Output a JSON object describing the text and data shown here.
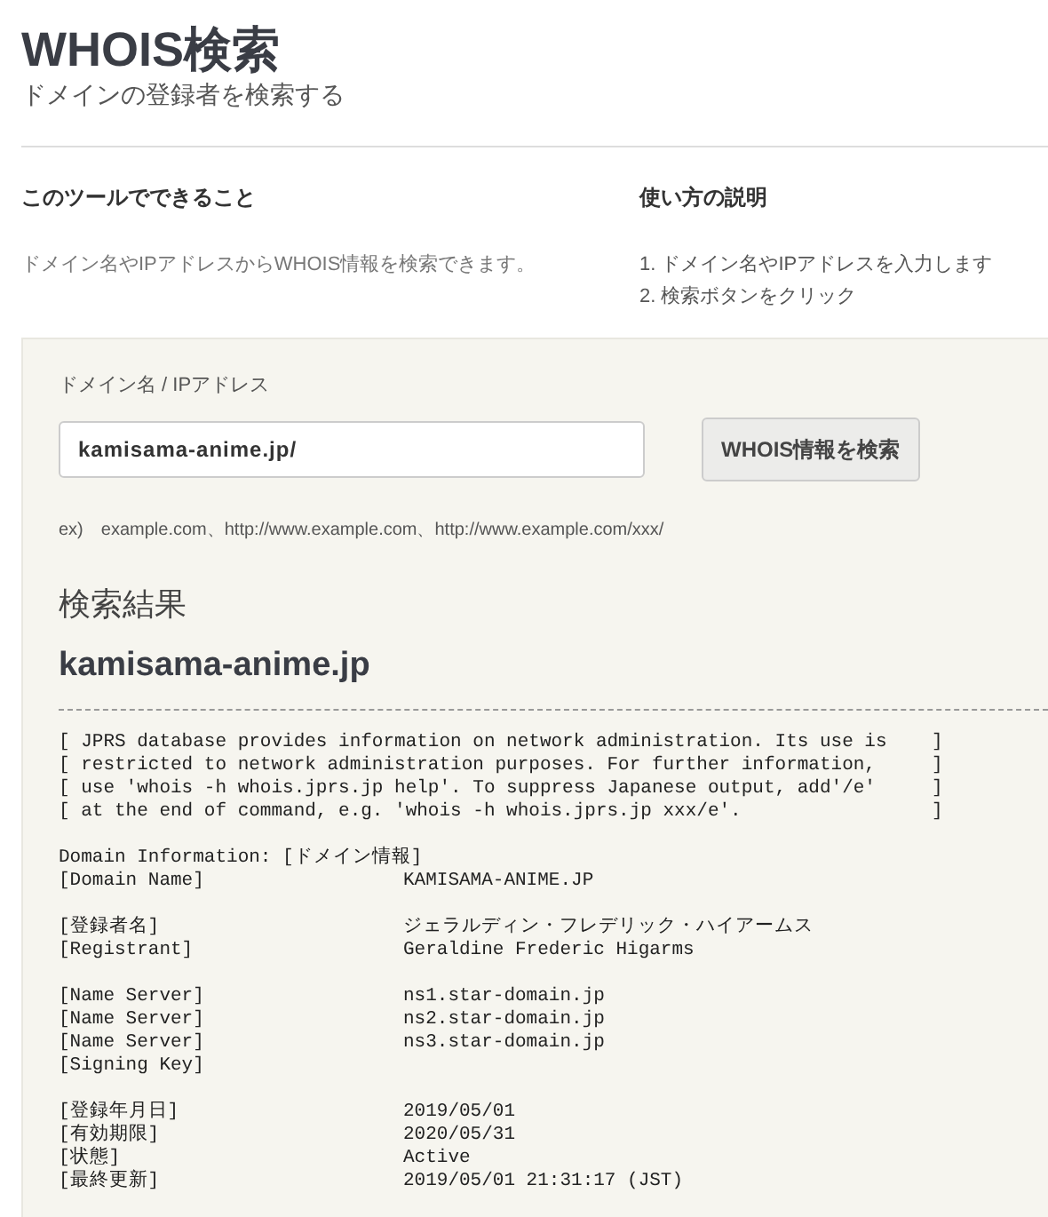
{
  "header": {
    "title": "WHOIS検索",
    "subtitle": "ドメインの登録者を検索する"
  },
  "intro": [
    {
      "heading": "このツールでできること",
      "kind": "text",
      "lines": [
        "ドメイン名やIPアドレスからWHOIS情報を検索できます。"
      ]
    },
    {
      "heading": "使い方の説明",
      "kind": "steps",
      "lines": [
        "1. ドメイン名やIPアドレスを入力します",
        "2. 検索ボタンをクリック"
      ]
    }
  ],
  "search": {
    "label": "ドメイン名 / IPアドレス",
    "value": "kamisama-anime.jp/",
    "button": "WHOIS情報を検索",
    "example": "ex)　example.com、http://www.example.com、http://www.example.com/xxx/"
  },
  "result": {
    "heading": "検索結果",
    "domain": "kamisama-anime.jp",
    "notice": [
      "[ JPRS database provides information on network administration. Its use is    ]",
      "[ restricted to network administration purposes. For further information,     ]",
      "[ use 'whois -h whois.jprs.jp help'. To suppress Japanese output, add'/e'     ]",
      "[ at the end of command, e.g. 'whois -h whois.jprs.jp xxx/e'.                 ]"
    ],
    "section_title": "Domain Information: [ドメイン情報]",
    "groups": [
      [
        {
          "label": "[Domain Name]",
          "value": "KAMISAMA-ANIME.JP"
        }
      ],
      [
        {
          "label": "[登録者名]",
          "value": "ジェラルディン・フレデリック・ハイアームス"
        },
        {
          "label": "[Registrant]",
          "value": "Geraldine Frederic Higarms"
        }
      ],
      [
        {
          "label": "[Name Server]",
          "value": "ns1.star-domain.jp"
        },
        {
          "label": "[Name Server]",
          "value": "ns2.star-domain.jp"
        },
        {
          "label": "[Name Server]",
          "value": "ns3.star-domain.jp"
        },
        {
          "label": "[Signing Key]"
        }
      ],
      [
        {
          "label": "[登録年月日]",
          "value": "2019/05/01"
        },
        {
          "label": "[有効期限]",
          "value": "2020/05/31"
        },
        {
          "label": "[状態]",
          "value": "Active"
        },
        {
          "label": "[最終更新]",
          "value": "2019/05/01 21:31:17 (JST)"
        }
      ]
    ]
  }
}
